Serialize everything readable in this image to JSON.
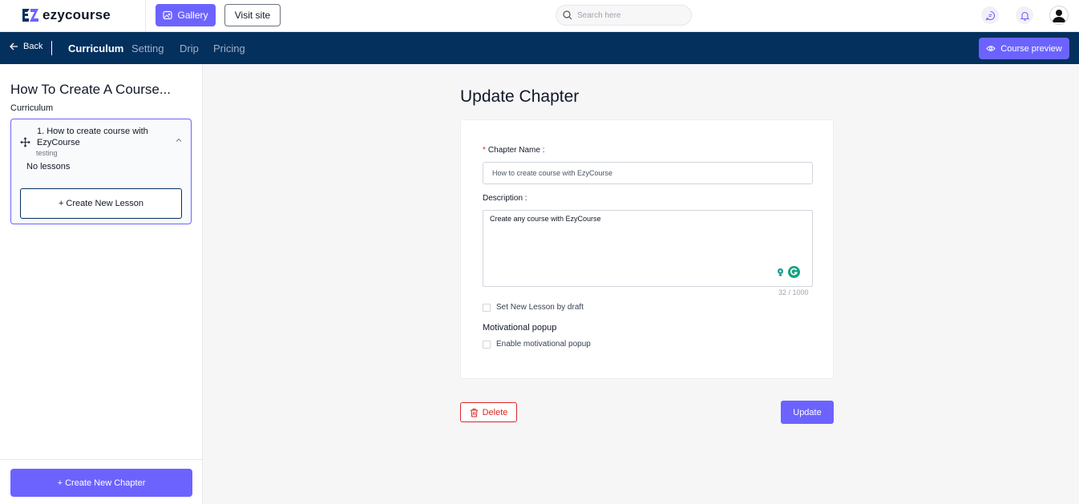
{
  "header": {
    "logo_text": "ezycourse",
    "gallery_label": "Gallery",
    "visit_site_label": "Visit site",
    "search_placeholder": "Search here",
    "icons": [
      "chat-icon",
      "bell-icon",
      "user-avatar-icon"
    ]
  },
  "navbar": {
    "back_label": "Back",
    "tabs": [
      {
        "label": "Curriculum",
        "active": true
      },
      {
        "label": "Setting",
        "active": false
      },
      {
        "label": "Drip",
        "active": false
      },
      {
        "label": "Pricing",
        "active": false
      }
    ],
    "preview_label": "Course preview"
  },
  "sidebar": {
    "course_title": "How To Create A Course...",
    "section_label": "Curriculum",
    "chapter": {
      "title": "1. How to create course with EzyCourse",
      "subtitle": "testing",
      "empty_text": "No lessons",
      "create_lesson_label": "+ Create New Lesson"
    },
    "create_chapter_label": "+ Create New Chapter"
  },
  "main": {
    "title": "Update Chapter",
    "form": {
      "chapter_name_label": "Chapter Name",
      "chapter_name_value": "How to create course with EzyCourse",
      "description_label": "Description",
      "description_value": "Create any course with EzyCourse",
      "counter": "32 / 1000",
      "draft_label": "Set New Lesson by draft",
      "motivational_title": "Motivational popup",
      "motivational_label": "Enable motivational popup"
    },
    "delete_label": "Delete",
    "update_label": "Update"
  },
  "colors": {
    "accent": "#6c63ff",
    "navbar": "#04305e",
    "danger": "#dc2626"
  }
}
